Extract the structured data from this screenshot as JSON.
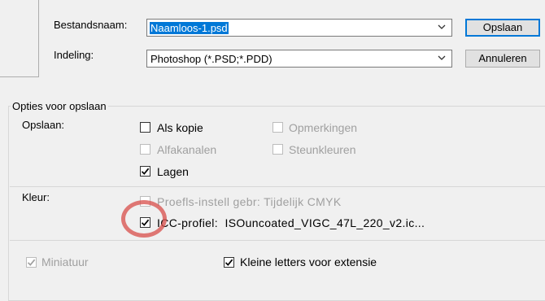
{
  "form": {
    "filename_label": "Bestandsnaam:",
    "filename_value": "Naamloos-1.psd",
    "format_label": "Indeling:",
    "format_value": "Photoshop (*.PSD;*.PDD)"
  },
  "buttons": {
    "save": "Opslaan",
    "cancel": "Annuleren"
  },
  "options": {
    "group_title": "Opties voor opslaan",
    "save_label": "Opslaan:",
    "as_copy": {
      "label": "Als kopie",
      "checked": false,
      "enabled": true
    },
    "notes": {
      "label": "Opmerkingen",
      "checked": false,
      "enabled": false
    },
    "alpha_channels": {
      "label": "Alfakanalen",
      "checked": false,
      "enabled": false
    },
    "spot_colors": {
      "label": "Steunkleuren",
      "checked": false,
      "enabled": false
    },
    "layers": {
      "label": "Lagen",
      "checked": true,
      "enabled": true
    }
  },
  "color": {
    "label": "Kleur:",
    "proof": {
      "label": "Proefls-instell gebr: Tijdelijk CMYK",
      "checked": false,
      "enabled": false
    },
    "icc": {
      "label": "ICC-profiel:  ISOuncoated_VIGC_47L_220_v2.ic...",
      "checked": true,
      "enabled": true
    }
  },
  "bottom": {
    "thumbnail": {
      "label": "Miniatuur",
      "checked": true,
      "enabled": false
    },
    "lowercase_ext": {
      "label": "Kleine letters voor extensie",
      "checked": true,
      "enabled": true
    }
  },
  "colors": {
    "selection": "#0078d7",
    "highlight_circle": "#d9534f",
    "disabled_text": "#a0a0a0"
  }
}
